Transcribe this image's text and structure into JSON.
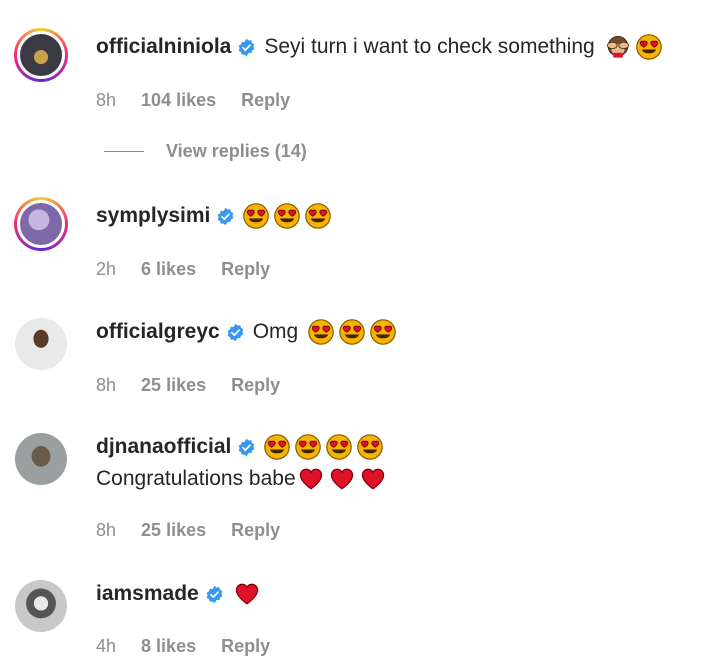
{
  "comments": [
    {
      "username": "officialniniola",
      "text": "Seyi turn i want to check something",
      "emojis": [
        "monkey",
        "heart-eyes"
      ],
      "time": "8h",
      "likes": "104 likes",
      "reply": "Reply",
      "view_replies": "View replies (14)"
    },
    {
      "username": "symplysimi",
      "text": "",
      "emojis": [
        "heart-eyes",
        "heart-eyes",
        "heart-eyes"
      ],
      "time": "2h",
      "likes": "6 likes",
      "reply": "Reply"
    },
    {
      "username": "officialgreyc",
      "text": "Omg",
      "emojis": [
        "heart-eyes",
        "heart-eyes",
        "heart-eyes"
      ],
      "time": "8h",
      "likes": "25 likes",
      "reply": "Reply"
    },
    {
      "username": "djnanaofficial",
      "text": "",
      "emojis": [
        "heart-eyes",
        "heart-eyes",
        "heart-eyes",
        "heart-eyes"
      ],
      "text2": "Congratulations babe",
      "emojis2": [
        "red-heart",
        "red-heart",
        "red-heart"
      ],
      "time": "8h",
      "likes": "25 likes",
      "reply": "Reply"
    },
    {
      "username": "iamsmade",
      "text": "",
      "emojis": [
        "red-heart"
      ],
      "time": "4h",
      "likes": "8 likes",
      "reply": "Reply"
    }
  ],
  "colors": {
    "verified": "#3897f0",
    "meta_text": "#8e8e8e",
    "primary_text": "#262626"
  }
}
